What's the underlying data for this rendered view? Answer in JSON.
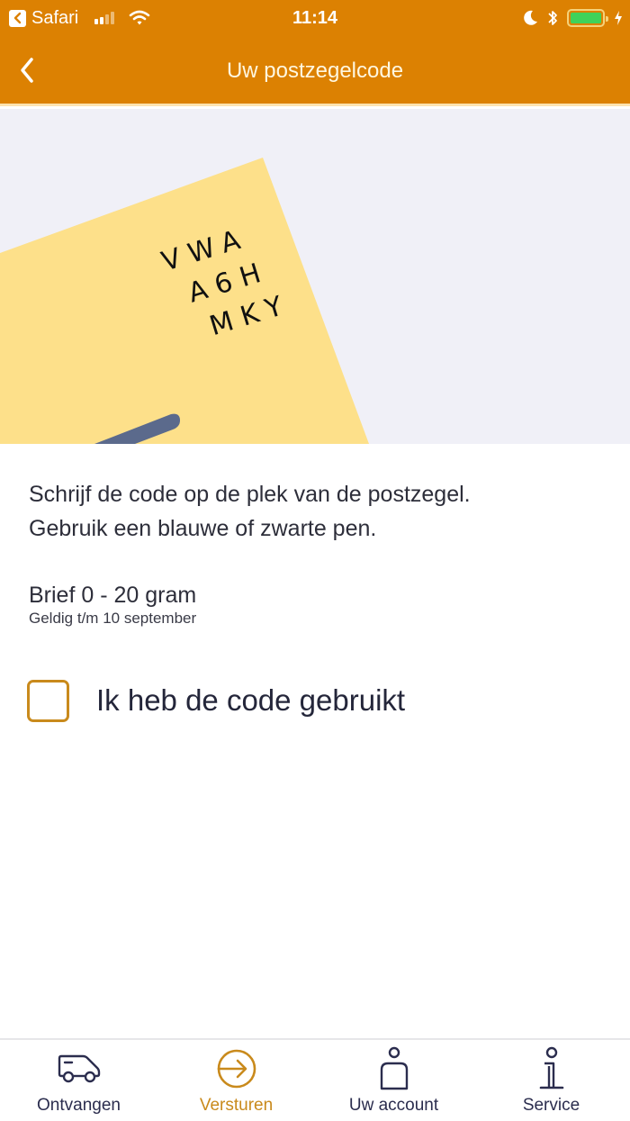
{
  "status_bar": {
    "back_app": "Safari",
    "time": "11:14",
    "signal_bars": 2,
    "signal_max": 4,
    "battery_level": 1.0,
    "battery_color": "#3fd25a",
    "icons": [
      "back-icon",
      "signal-icon",
      "wifi-icon",
      "moon-icon",
      "bluetooth-icon",
      "battery-icon",
      "charging-icon"
    ]
  },
  "nav": {
    "title": "Uw postzegelcode",
    "back_icon": "chevron-left-icon"
  },
  "illustration": {
    "code_lines": [
      "VWA",
      "A6H",
      "MKY"
    ],
    "envelope_color": "#fde08a",
    "pen_color": "#5b6a8c"
  },
  "content": {
    "instruction_line1": "Schrijf de code op de plek van de postzegel.",
    "instruction_line2": "Gebruik een blauwe of zwarte pen.",
    "product": "Brief 0 - 20 gram",
    "validity": "Geldig t/m 10 september"
  },
  "checkbox": {
    "label": "Ik heb de code gebruikt",
    "checked": false
  },
  "colors": {
    "brand_orange": "#dc8102",
    "accent_gold": "#c98a1c",
    "text_dark": "#2d2e3a",
    "tab_navy": "#2b2d4e"
  },
  "tab_bar": {
    "active_index": 1,
    "tabs": [
      {
        "label": "Ontvangen",
        "icon": "van-icon"
      },
      {
        "label": "Versturen",
        "icon": "arrow-circle-icon"
      },
      {
        "label": "Uw account",
        "icon": "person-icon"
      },
      {
        "label": "Service",
        "icon": "info-icon"
      }
    ]
  }
}
